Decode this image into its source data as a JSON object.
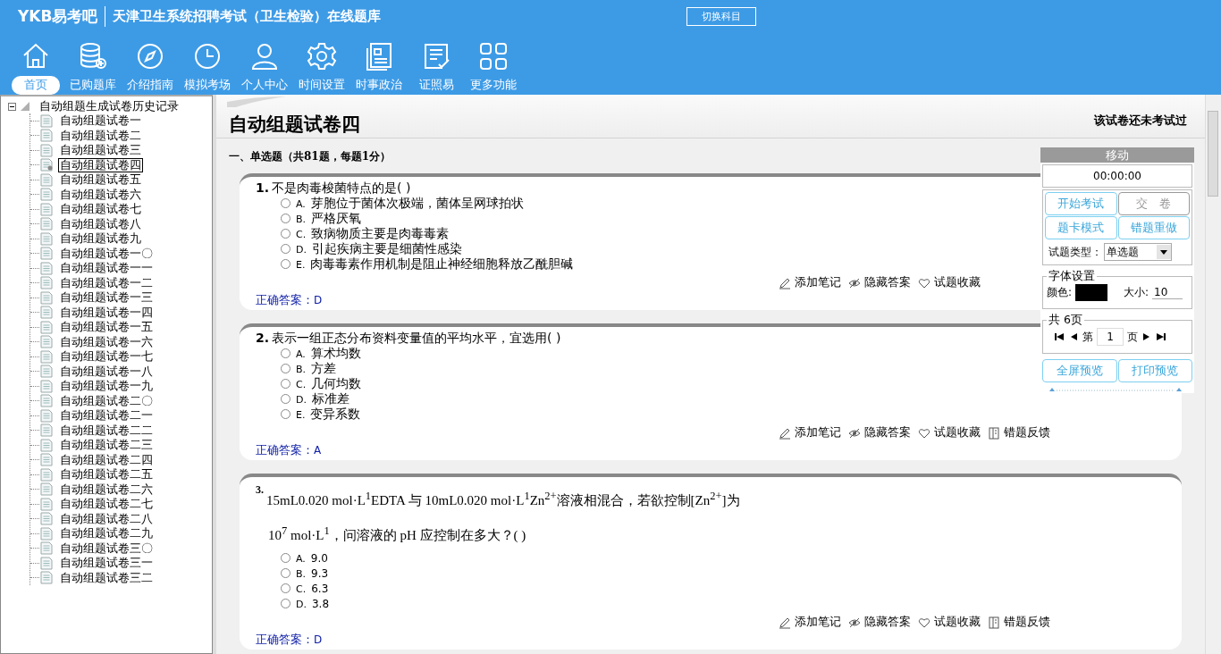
{
  "header": {
    "logo": "YKB易考吧",
    "title": "天津卫生系统招聘考试（卫生检验）在线题库",
    "switch_button": "切换科目"
  },
  "nav": [
    {
      "label": "首页",
      "selected": true
    },
    {
      "label": "已购题库",
      "selected": false
    },
    {
      "label": "介绍指南",
      "selected": false
    },
    {
      "label": "模拟考场",
      "selected": false
    },
    {
      "label": "个人中心",
      "selected": false
    },
    {
      "label": "时间设置",
      "selected": false
    },
    {
      "label": "时事政治",
      "selected": false
    },
    {
      "label": "证照易",
      "selected": false
    },
    {
      "label": "更多功能",
      "selected": false
    }
  ],
  "tree": {
    "label": "自动组题生成试卷历史记录",
    "expanded": true,
    "children": [
      {
        "label": "自动组题试卷一",
        "selected": false
      },
      {
        "label": "自动组题试卷二",
        "selected": false
      },
      {
        "label": "自动组题试卷三",
        "selected": false
      },
      {
        "label": "自动组题试卷四",
        "selected": true
      },
      {
        "label": "自动组题试卷五",
        "selected": false
      },
      {
        "label": "自动组题试卷六",
        "selected": false
      },
      {
        "label": "自动组题试卷七",
        "selected": false
      },
      {
        "label": "自动组题试卷八",
        "selected": false
      },
      {
        "label": "自动组题试卷九",
        "selected": false
      },
      {
        "label": "自动组题试卷一〇",
        "selected": false
      },
      {
        "label": "自动组题试卷一一",
        "selected": false
      },
      {
        "label": "自动组题试卷一二",
        "selected": false
      },
      {
        "label": "自动组题试卷一三",
        "selected": false
      },
      {
        "label": "自动组题试卷一四",
        "selected": false
      },
      {
        "label": "自动组题试卷一五",
        "selected": false
      },
      {
        "label": "自动组题试卷一六",
        "selected": false
      },
      {
        "label": "自动组题试卷一七",
        "selected": false
      },
      {
        "label": "自动组题试卷一八",
        "selected": false
      },
      {
        "label": "自动组题试卷一九",
        "selected": false
      },
      {
        "label": "自动组题试卷二〇",
        "selected": false
      },
      {
        "label": "自动组题试卷二一",
        "selected": false
      },
      {
        "label": "自动组题试卷二二",
        "selected": false
      },
      {
        "label": "自动组题试卷二三",
        "selected": false
      },
      {
        "label": "自动组题试卷二四",
        "selected": false
      },
      {
        "label": "自动组题试卷二五",
        "selected": false
      },
      {
        "label": "自动组题试卷二六",
        "selected": false
      },
      {
        "label": "自动组题试卷二七",
        "selected": false
      },
      {
        "label": "自动组题试卷二八",
        "selected": false
      },
      {
        "label": "自动组题试卷二九",
        "selected": false
      },
      {
        "label": "自动组题试卷三〇",
        "selected": false
      },
      {
        "label": "自动组题试卷三一",
        "selected": false
      },
      {
        "label": "自动组题试卷三二",
        "selected": false
      }
    ]
  },
  "paper": {
    "title": "自动组题试卷四",
    "status": "该试卷还未考试过",
    "section": "一、单选题（共81题，每题1分）",
    "questions": [
      {
        "kind": "plain",
        "number": "1.",
        "lines": [
          "不是肉毒梭菌特点的是(  )"
        ],
        "options": [
          {
            "label": "A.",
            "text": "芽胞位于菌体次极端，菌体呈网球拍状",
            "selected": false
          },
          {
            "label": "B.",
            "text": "严格厌氧",
            "selected": false
          },
          {
            "label": "C.",
            "text": "致病物质主要是肉毒毒素",
            "selected": false
          },
          {
            "label": "D.",
            "text": "引起疾病主要是细菌性感染",
            "selected": false
          },
          {
            "label": "E.",
            "text": "肉毒毒素作用机制是阻止神经细胞释放乙酰胆碱",
            "selected": false
          }
        ],
        "actions": [
          "添加笔记",
          "隐藏答案",
          "试题收藏"
        ],
        "answer_label": "正确答案：",
        "answer": "D"
      },
      {
        "kind": "plain",
        "number": "2.",
        "lines": [
          "表示一组正态分布资料变量值的平均水平，宜选用(  )"
        ],
        "options": [
          {
            "label": "A.",
            "text": "算术均数",
            "selected": false
          },
          {
            "label": "B.",
            "text": "方差",
            "selected": false
          },
          {
            "label": "C.",
            "text": "几何均数",
            "selected": false
          },
          {
            "label": "D.",
            "text": "标准差",
            "selected": false
          },
          {
            "label": "E.",
            "text": "变异系数",
            "selected": false
          }
        ],
        "actions": [
          "添加笔记",
          "隐藏答案",
          "试题收藏",
          "错题反馈"
        ],
        "answer_label": "正确答案：",
        "answer": "A"
      },
      {
        "kind": "formula",
        "number": "3.",
        "lines": [
          "15mL0.020 mol·L$^{1}$EDTA 与 10mL0.020 mol·L$^{1}$Zn$^{2+}$溶液相混合，若欲控制[Zn$^{2+}$]为",
          "10$^{7}$ mol·L$^{1}$，问溶液的 pH 应控制在多大？(    )"
        ],
        "options": [
          {
            "label": "A.",
            "text": "9.0",
            "selected": false
          },
          {
            "label": "B.",
            "text": "9.3",
            "selected": false
          },
          {
            "label": "C.",
            "text": "6.3",
            "selected": false
          },
          {
            "label": "D.",
            "text": "3.8",
            "selected": false
          }
        ],
        "actions": [
          "添加笔记",
          "隐藏答案",
          "试题收藏",
          "错题反馈"
        ],
        "answer_label": "正确答案：",
        "answer": "D"
      }
    ]
  },
  "panel": {
    "title": "移动",
    "timer": "00:00:00",
    "buttons": [
      {
        "label": "开始考试",
        "disabled": false
      },
      {
        "label": "交　卷",
        "disabled": true
      },
      {
        "label": "题卡模式",
        "disabled": false
      },
      {
        "label": "错题重做",
        "disabled": false
      }
    ],
    "type_label": "试题类型：",
    "type_value": "单选题",
    "font_legend": "字体设置",
    "color_label": "颜色:",
    "swatch": {
      "color": "#000000"
    },
    "size_label": "大小:",
    "size_value": "10",
    "page_legend": "共 6页",
    "page_prefix": "第",
    "page_value": "1",
    "page_suffix": "页",
    "bottom_buttons": [
      "全屏预览",
      "打印预览"
    ]
  }
}
